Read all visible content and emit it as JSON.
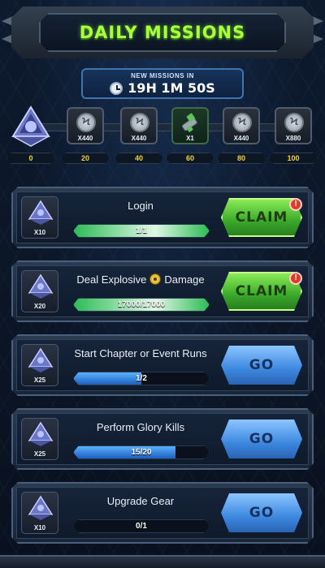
{
  "header": {
    "title": "DAILY MISSIONS"
  },
  "timer": {
    "label": "NEW MISSIONS IN",
    "value": "19H 1M 50S"
  },
  "track": {
    "rewards": [
      {
        "qty": "X440",
        "icon": "coin-icon"
      },
      {
        "qty": "X440",
        "icon": "coin-icon"
      },
      {
        "qty": "X1",
        "icon": "gear-icon"
      },
      {
        "qty": "X440",
        "icon": "coin-icon"
      },
      {
        "qty": "X880",
        "icon": "coin-icon"
      }
    ],
    "thresholds": [
      "0",
      "20",
      "40",
      "60",
      "80",
      "100"
    ]
  },
  "missions": [
    {
      "title": "Login",
      "reward_qty": "X10",
      "progress": "1/1",
      "fraction": 1.0,
      "button": "CLAIM",
      "state": "claim"
    },
    {
      "title_a": "Deal Explosive",
      "title_b": "Damage",
      "reward_qty": "X20",
      "progress": "17000/17000",
      "fraction": 1.0,
      "button": "CLAIM",
      "state": "claim"
    },
    {
      "title": "Start Chapter or Event Runs",
      "reward_qty": "X25",
      "progress": "1/2",
      "fraction": 0.5,
      "button": "GO",
      "state": "go"
    },
    {
      "title": "Perform Glory Kills",
      "reward_qty": "X25",
      "progress": "15/20",
      "fraction": 0.75,
      "button": "GO",
      "state": "go"
    },
    {
      "title": "Upgrade Gear",
      "reward_qty": "X10",
      "progress": "0/1",
      "fraction": 0.0,
      "button": "GO",
      "state": "go"
    }
  ],
  "alert_mark": "!",
  "colors": {
    "title": "#a8ff3e",
    "claim": "#3aa82a",
    "go": "#3d88e0",
    "threshold": "#f2d23a"
  }
}
